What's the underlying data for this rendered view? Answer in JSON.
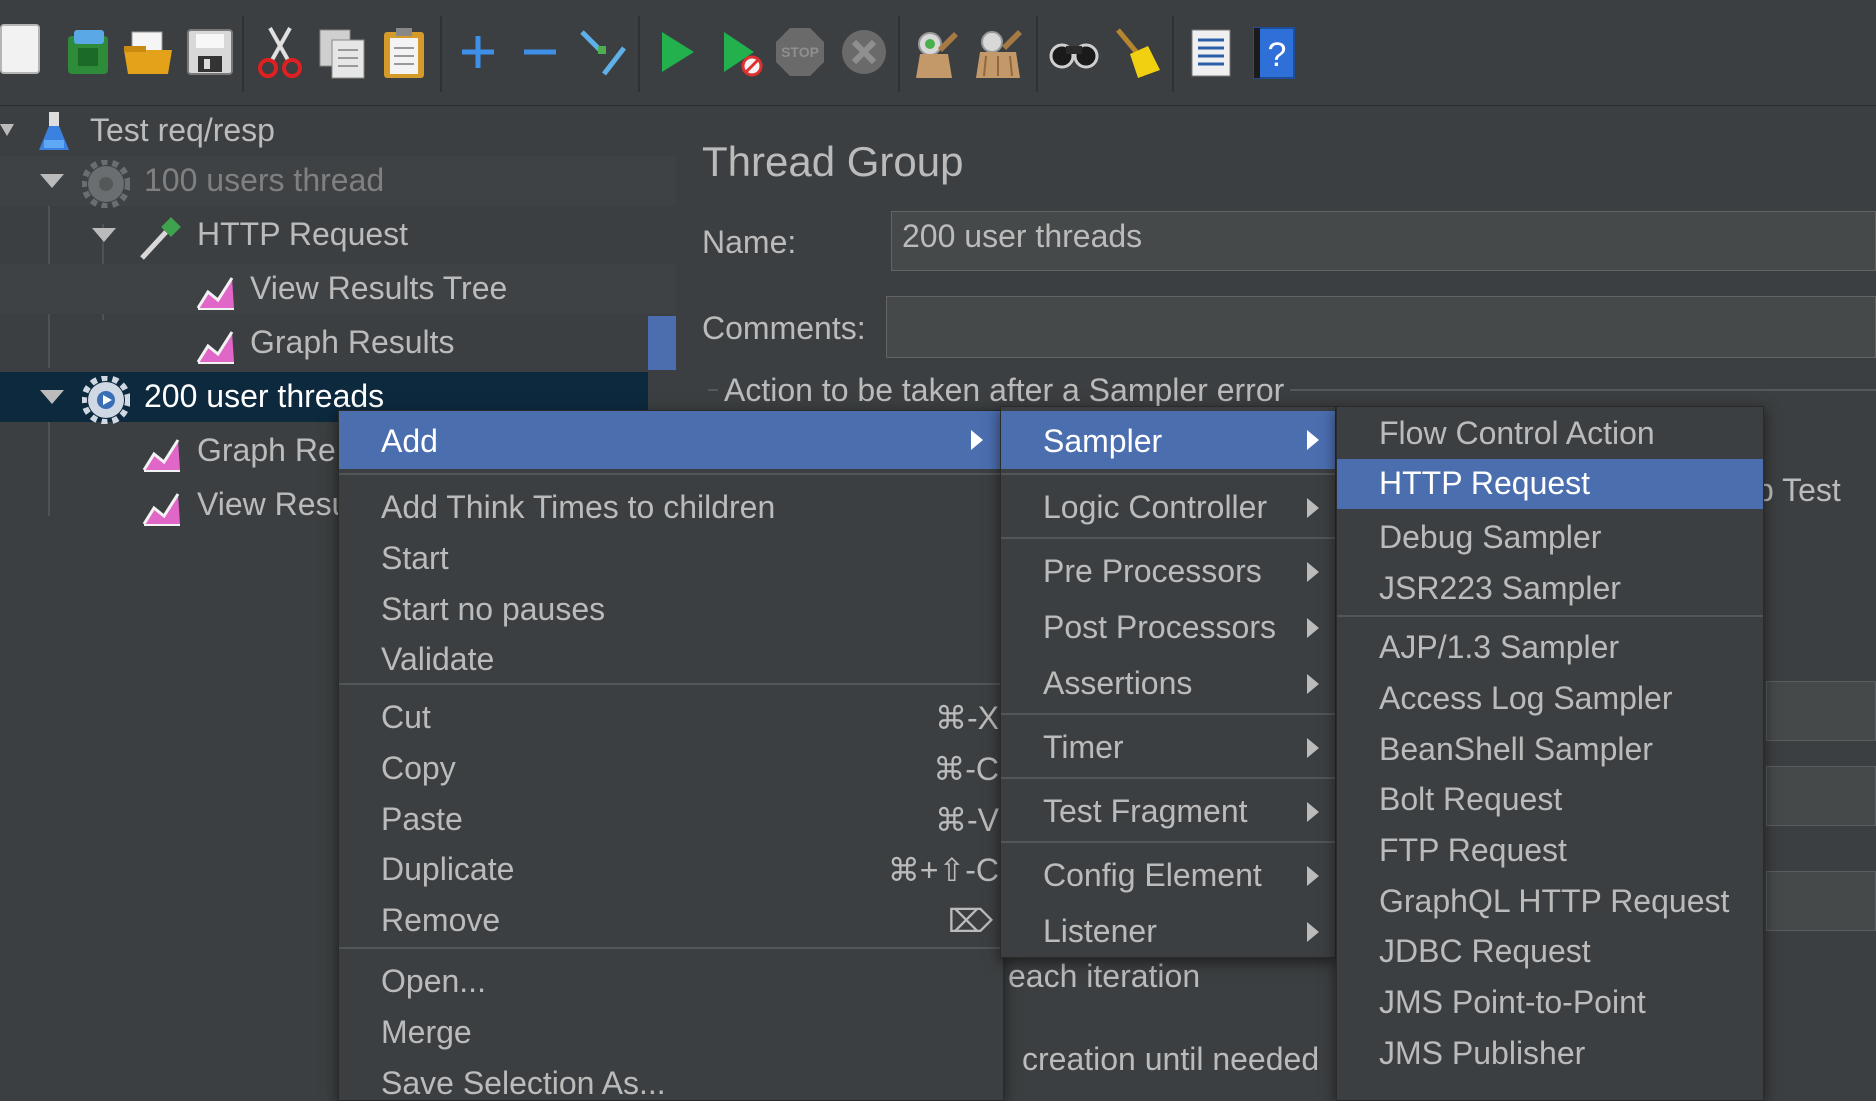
{
  "toolbar": {
    "icons": [
      "new-icon",
      "templates-icon",
      "open-icon",
      "save-icon",
      "cut-icon",
      "copy-icon",
      "paste-icon",
      "expand-icon",
      "collapse-icon",
      "toggle-icon",
      "start-icon",
      "start-no-pauses-icon",
      "stop-icon",
      "shutdown-icon",
      "clear-icon",
      "clear-all-icon",
      "search-icon",
      "reset-search-icon",
      "function-helper-icon",
      "help-icon"
    ],
    "stop_label": "STOP"
  },
  "tree": {
    "root": "Test req/resp",
    "thread1": "100 users thread",
    "http_request": "HTTP Request",
    "view_results_tree": "View Results Tree",
    "graph_results": "Graph Results",
    "thread2": "200 user threads",
    "child_graph": "Graph Re",
    "child_view": "View Resu"
  },
  "editor": {
    "title": "Thread Group",
    "name_label": "Name:",
    "name_value": "200 user threads",
    "comments_label": "Comments:",
    "comments_value": "",
    "error_section": "Action to be taken after a Sampler error",
    "stop_test_fragment": "p Test",
    "each_iteration_fragment": "each iteration",
    "creation_fragment": "creation until needed"
  },
  "context_menu": {
    "add": "Add",
    "add_think_times": "Add Think Times to children",
    "start": "Start",
    "start_no_pauses": "Start no pauses",
    "validate": "Validate",
    "cut": "Cut",
    "cut_sc": "⌘-X",
    "copy": "Copy",
    "copy_sc": "⌘-C",
    "paste": "Paste",
    "paste_sc": "⌘-V",
    "duplicate": "Duplicate",
    "duplicate_sc": "⌘+⇧-C",
    "remove": "Remove",
    "remove_sc": "⌦",
    "open": "Open...",
    "merge": "Merge",
    "save_selection": "Save Selection As..."
  },
  "add_menu": {
    "sampler": "Sampler",
    "logic_controller": "Logic Controller",
    "pre_processors": "Pre Processors",
    "post_processors": "Post Processors",
    "assertions": "Assertions",
    "timer": "Timer",
    "test_fragment": "Test Fragment",
    "config_element": "Config Element",
    "listener": "Listener"
  },
  "sampler_menu": {
    "flow_control_action": "Flow Control Action",
    "http_request": "HTTP Request",
    "debug_sampler": "Debug Sampler",
    "jsr223_sampler": "JSR223 Sampler",
    "ajp_sampler": "AJP/1.3 Sampler",
    "access_log_sampler": "Access Log Sampler",
    "beanshell_sampler": "BeanShell Sampler",
    "bolt_request": "Bolt Request",
    "ftp_request": "FTP Request",
    "graphql_http_request": "GraphQL HTTP Request",
    "jdbc_request": "JDBC Request",
    "jms_point_to_point": "JMS Point-to-Point",
    "jms_publisher": "JMS Publisher"
  },
  "colors": {
    "background": "#3c3f41",
    "selection": "#4b6eaf",
    "tree_selection": "#0d293e",
    "text": "#bbbbbb"
  }
}
